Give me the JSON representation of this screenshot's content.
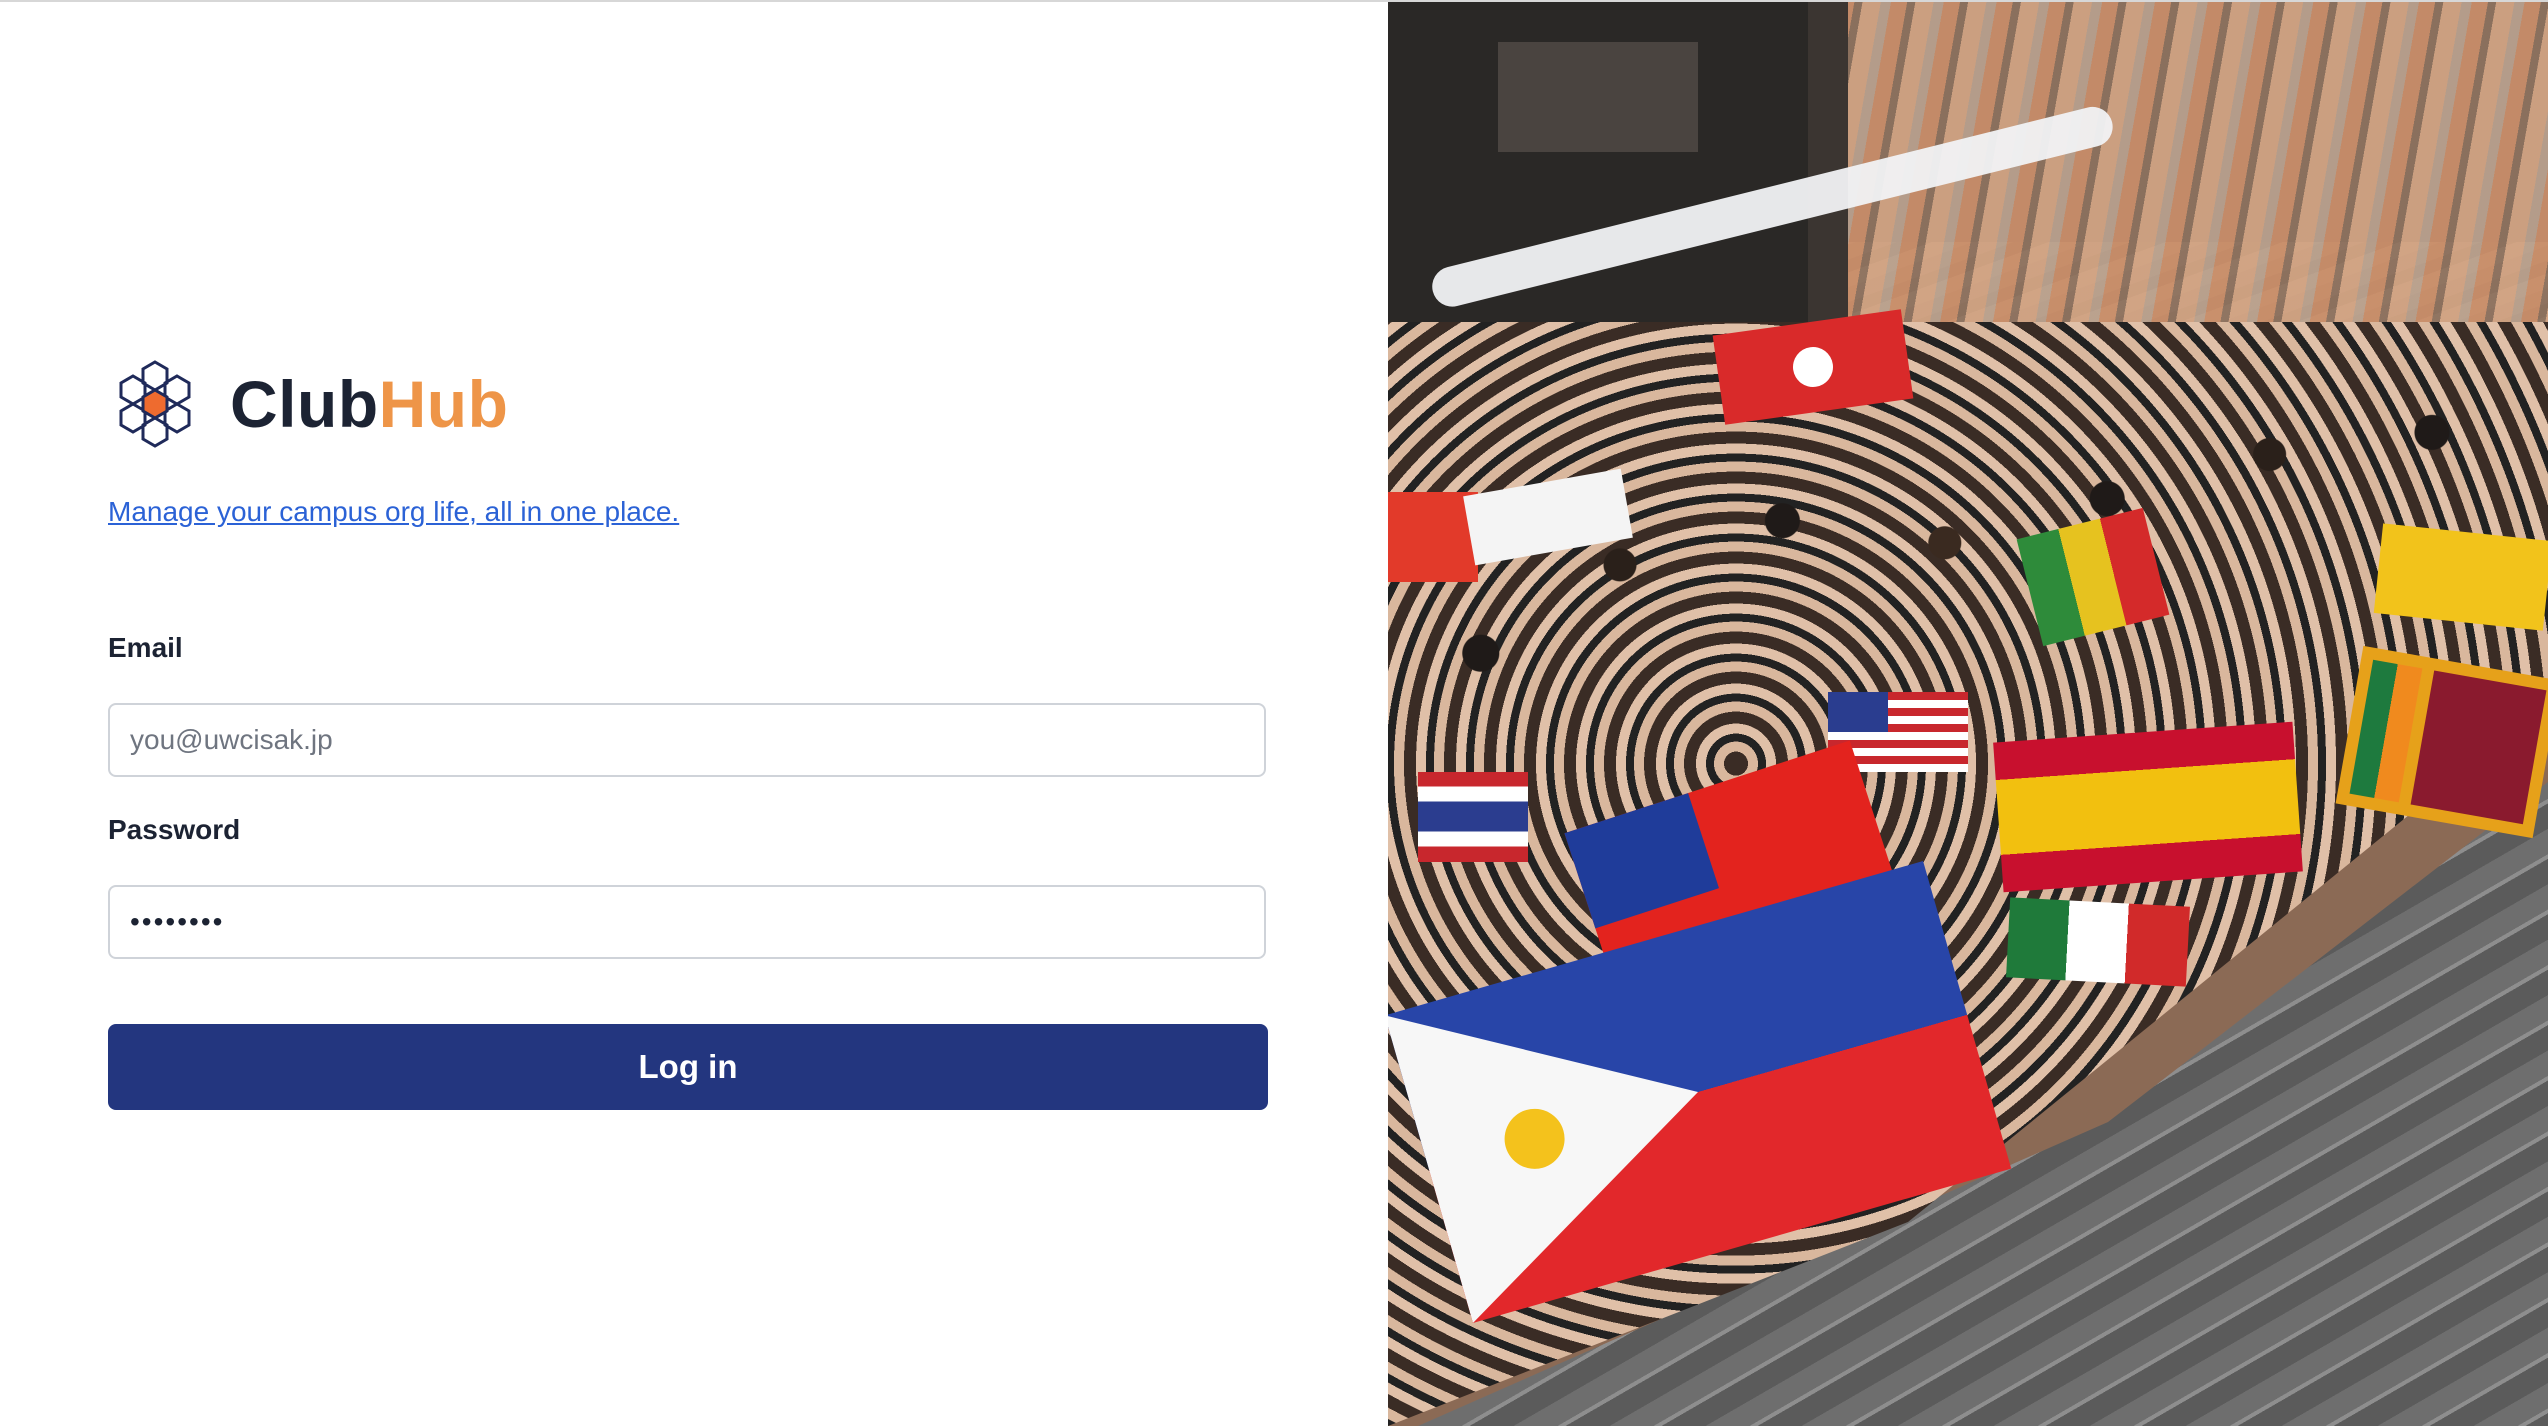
{
  "brand": {
    "name_part1": "Club",
    "name_part2": "Hub",
    "logo_icon": "hexagon-cluster-icon",
    "colors": {
      "primary": "#1c2333",
      "accent": "#ee9548"
    }
  },
  "tagline": "Manage your campus org life, all in one place.",
  "form": {
    "email": {
      "label": "Email",
      "placeholder": "you@uwcisak.jp",
      "value": ""
    },
    "password": {
      "label": "Password",
      "value": "••••••••"
    },
    "submit_label": "Log in",
    "submit_color": "#23367f"
  },
  "hero_image": {
    "icon": "campus-crowd-with-flags-photo"
  }
}
